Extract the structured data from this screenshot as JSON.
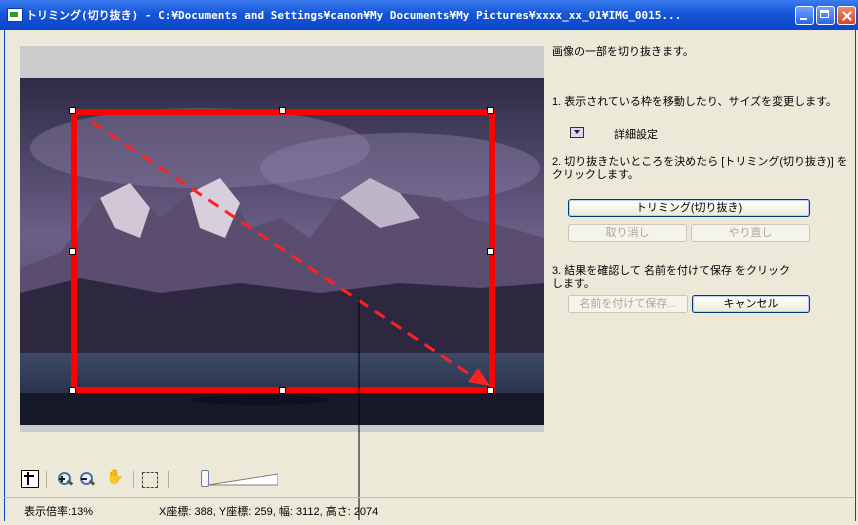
{
  "window": {
    "title": "トリミング(切り抜き) - C:¥Documents and Settings¥canon¥My Documents¥My Pictures¥xxxx_xx_01¥IMG_0015...",
    "minimize_icon": "minimize-icon",
    "maximize_icon": "maximize-icon",
    "close_icon": "close-icon"
  },
  "panel": {
    "intro": "画像の一部を切り抜きます。",
    "step1": "1. 表示されている枠を移動したり、サイズを変更します。",
    "advanced_label": "詳細設定",
    "step2_line1": "2. 切り抜きたいところを決めたら [トリミング(切り抜き)] を",
    "step2_line2": "クリックします。",
    "trim_button": "トリミング(切り抜き)",
    "undo_button": "取り消し",
    "redo_button": "やり直し",
    "step3_line1": "3. 結果を確認して 名前を付けて保存 をクリック",
    "step3_line2": "します。",
    "save_as_button": "名前を付けて保存...",
    "cancel_button": "キャンセル"
  },
  "toolbar": {
    "icons": [
      "crop-tool-icon",
      "zoom-in-icon",
      "zoom-out-icon",
      "hand-icon",
      "fit-to-window-icon"
    ],
    "zoom_slider_level": 0.13
  },
  "status": {
    "zoom": "表示倍率:13%",
    "coords": "X座標: 388, Y座標: 259, 幅: 3112, 高さ: 2074"
  },
  "colors": {
    "title_bar": "#1756d6",
    "crop_frame": "#ff0000",
    "window_bg": "#ece9d8"
  }
}
